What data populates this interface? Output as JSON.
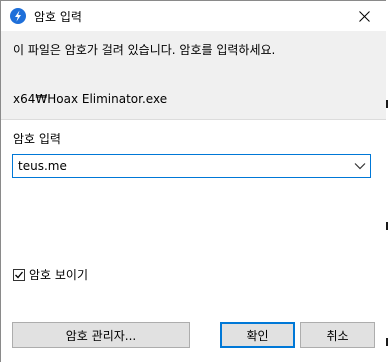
{
  "window": {
    "title": "암호 입력",
    "close_glyph": "✕"
  },
  "dialog": {
    "message": "이 파일은 암호가 걸려 있습니다. 암호를 입력하세요.",
    "file_path": "x64₩Hoax Eliminator.exe",
    "password_label": "암호 입력",
    "password_value": "teus.me",
    "show_password_label": "암호 보이기",
    "show_password_checked": true
  },
  "buttons": {
    "manager": "암호 관리자...",
    "ok": "확인",
    "cancel": "취소"
  },
  "colors": {
    "accent": "#0078d7",
    "icon_blue": "#1e6fd9"
  }
}
